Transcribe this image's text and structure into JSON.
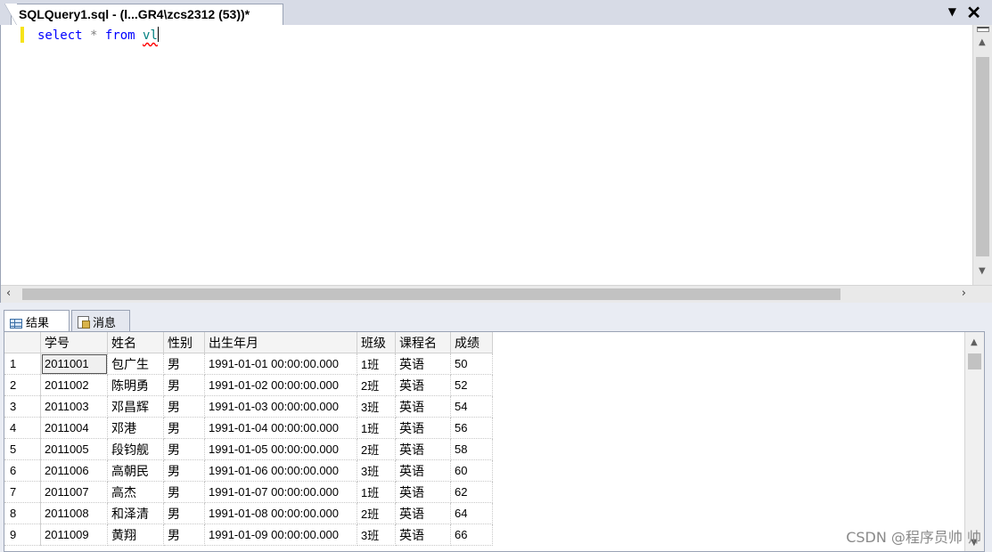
{
  "tab": {
    "title": "SQLQuery1.sql - (l...GR4\\zcs2312 (53))*"
  },
  "window_controls": {
    "dropdown": "▼",
    "close": "✕"
  },
  "editor": {
    "tokens": {
      "kw1": "select",
      "star": "*",
      "kw2": "from",
      "table": "vl"
    }
  },
  "results": {
    "tabs": [
      {
        "label": "结果"
      },
      {
        "label": "消息"
      }
    ],
    "columns": [
      "",
      "学号",
      "姓名",
      "性别",
      "出生年月",
      "班级",
      "课程名",
      "成绩"
    ],
    "rows": [
      [
        "1",
        "2011001",
        "包广生",
        "男",
        "1991-01-01 00:00:00.000",
        "1班",
        "英语",
        "50"
      ],
      [
        "2",
        "2011002",
        "陈明勇",
        "男",
        "1991-01-02 00:00:00.000",
        "2班",
        "英语",
        "52"
      ],
      [
        "3",
        "2011003",
        "邓昌辉",
        "男",
        "1991-01-03 00:00:00.000",
        "3班",
        "英语",
        "54"
      ],
      [
        "4",
        "2011004",
        "邓港",
        "男",
        "1991-01-04 00:00:00.000",
        "1班",
        "英语",
        "56"
      ],
      [
        "5",
        "2011005",
        "段钧舰",
        "男",
        "1991-01-05 00:00:00.000",
        "2班",
        "英语",
        "58"
      ],
      [
        "6",
        "2011006",
        "高朝民",
        "男",
        "1991-01-06 00:00:00.000",
        "3班",
        "英语",
        "60"
      ],
      [
        "7",
        "2011007",
        "高杰",
        "男",
        "1991-01-07 00:00:00.000",
        "1班",
        "英语",
        "62"
      ],
      [
        "8",
        "2011008",
        "和泽清",
        "男",
        "1991-01-08 00:00:00.000",
        "2班",
        "英语",
        "64"
      ],
      [
        "9",
        "2011009",
        "黄翔",
        "男",
        "1991-01-09 00:00:00.000",
        "3班",
        "英语",
        "66"
      ]
    ]
  },
  "watermark": "CSDN @程序员帅 帅"
}
